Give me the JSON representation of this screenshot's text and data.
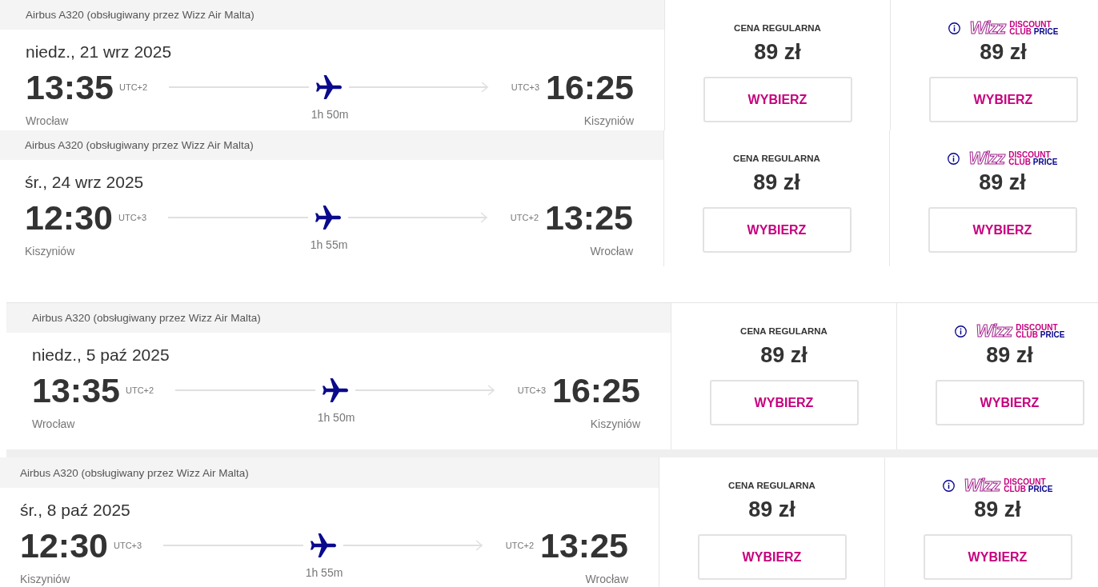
{
  "flights": [
    {
      "aircraft": "Airbus A320 (obsługiwany przez Wizz Air Malta)",
      "date": "niedz., 21 wrz 2025",
      "departure": {
        "time": "13:35",
        "utc": "UTC+2",
        "city": "Wrocław"
      },
      "arrival": {
        "time": "16:25",
        "utc": "UTC+3",
        "city": "Kiszyniów"
      },
      "duration": "1h 50m",
      "fares": [
        {
          "kind": "regular",
          "label": "CENA REGULARNA",
          "price": "89 zł",
          "button": "WYBIERZ"
        },
        {
          "kind": "club",
          "wordmark": "Wizz",
          "tagline": [
            "DISCOUNT",
            "CLUB",
            "PRICE"
          ],
          "price": "89 zł",
          "button": "WYBIERZ"
        }
      ]
    },
    {
      "aircraft": "Airbus A320 (obsługiwany przez Wizz Air Malta)",
      "date": "śr., 24 wrz 2025",
      "departure": {
        "time": "12:30",
        "utc": "UTC+3",
        "city": "Kiszyniów"
      },
      "arrival": {
        "time": "13:25",
        "utc": "UTC+2",
        "city": "Wrocław"
      },
      "duration": "1h 55m",
      "fares": [
        {
          "kind": "regular",
          "label": "CENA REGULARNA",
          "price": "89 zł",
          "button": "WYBIERZ"
        },
        {
          "kind": "club",
          "wordmark": "Wizz",
          "tagline": [
            "DISCOUNT",
            "CLUB",
            "PRICE"
          ],
          "price": "89 zł",
          "button": "WYBIERZ"
        }
      ]
    },
    {
      "aircraft": "Airbus A320 (obsługiwany przez Wizz Air Malta)",
      "date": "niedz., 5 paź 2025",
      "departure": {
        "time": "13:35",
        "utc": "UTC+2",
        "city": "Wrocław"
      },
      "arrival": {
        "time": "16:25",
        "utc": "UTC+3",
        "city": "Kiszyniów"
      },
      "duration": "1h 50m",
      "fares": [
        {
          "kind": "regular",
          "label": "CENA REGULARNA",
          "price": "89 zł",
          "button": "WYBIERZ"
        },
        {
          "kind": "club",
          "wordmark": "Wizz",
          "tagline": [
            "DISCOUNT",
            "CLUB",
            "PRICE"
          ],
          "price": "89 zł",
          "button": "WYBIERZ"
        }
      ]
    },
    {
      "aircraft": "Airbus A320 (obsługiwany przez Wizz Air Malta)",
      "date": "śr., 8 paź 2025",
      "departure": {
        "time": "12:30",
        "utc": "UTC+3",
        "city": "Kiszyniów"
      },
      "arrival": {
        "time": "13:25",
        "utc": "UTC+2",
        "city": "Wrocław"
      },
      "duration": "1h 55m",
      "fares": [
        {
          "kind": "regular",
          "label": "CENA REGULARNA",
          "price": "89 zł",
          "button": "WYBIERZ"
        },
        {
          "kind": "club",
          "wordmark": "Wizz",
          "tagline": [
            "DISCOUNT",
            "CLUB",
            "PRICE"
          ],
          "price": "89 zł",
          "button": "WYBIERZ"
        }
      ]
    }
  ]
}
